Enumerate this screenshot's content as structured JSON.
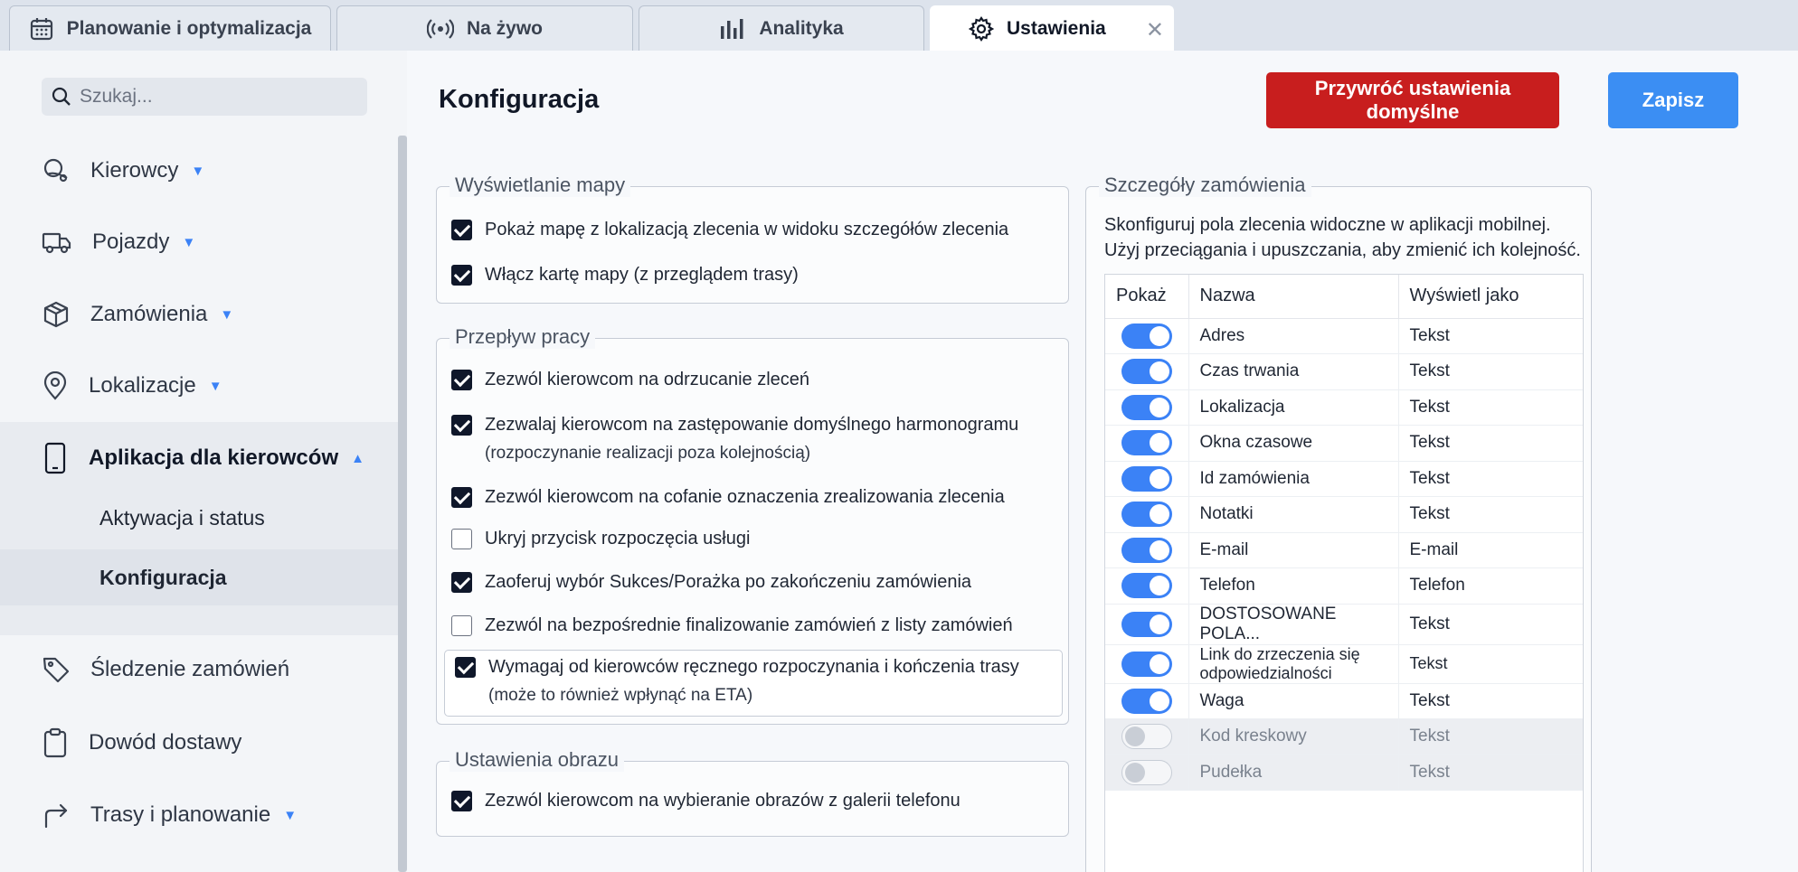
{
  "tabs": [
    {
      "label": "Planowanie i optymalizacja",
      "icon": "calendar-icon"
    },
    {
      "label": "Na żywo",
      "icon": "live-signal-icon"
    },
    {
      "label": "Analityka",
      "icon": "bar-chart-icon"
    },
    {
      "label": "Ustawienia",
      "icon": "gear-icon",
      "active": true
    }
  ],
  "tab_close": "✕",
  "sidebar": {
    "search_placeholder": "Szukaj...",
    "items": [
      {
        "label": "Kierowcy",
        "icon": "drivers-icon",
        "expandable": true
      },
      {
        "label": "Pojazdy",
        "icon": "truck-icon",
        "expandable": true
      },
      {
        "label": "Zamówienia",
        "icon": "box-icon",
        "expandable": true
      },
      {
        "label": "Lokalizacje",
        "icon": "location-pin-icon",
        "expandable": true
      },
      {
        "label": "Aplikacja dla kierowców",
        "icon": "phone-icon",
        "expanded": true
      },
      {
        "label": "Śledzenie zamówień",
        "icon": "tag-icon"
      },
      {
        "label": "Dowód dostawy",
        "icon": "clipboard-icon"
      },
      {
        "label": "Trasy i planowanie",
        "icon": "route-arrow-icon",
        "expandable": true
      }
    ],
    "subitems": [
      {
        "label": "Aktywacja i status"
      },
      {
        "label": "Konfiguracja",
        "selected": true
      }
    ]
  },
  "main": {
    "title": "Konfiguracja",
    "reset_label": "Przywróć ustawienia domyślne",
    "save_label": "Zapisz"
  },
  "map_display": {
    "legend": "Wyświetlanie mapy",
    "options": [
      {
        "label": "Pokaż mapę z lokalizacją zlecenia w widoku szczegółów zlecenia",
        "checked": true
      },
      {
        "label": "Włącz kartę mapy (z przeglądem trasy)",
        "checked": true
      }
    ]
  },
  "workflow": {
    "legend": "Przepływ pracy",
    "options": [
      {
        "label": "Zezwól kierowcom na odrzucanie zleceń",
        "checked": true
      },
      {
        "label": "Zezwalaj kierowcom na zastępowanie domyślnego harmonogramu",
        "sub": "(rozpoczynanie realizacji poza kolejnością)",
        "checked": true
      },
      {
        "label": "Zezwól kierowcom na cofanie oznaczenia zrealizowania zlecenia",
        "checked": true
      },
      {
        "label": "Ukryj przycisk rozpoczęcia usługi",
        "checked": false
      },
      {
        "label": "Zaoferuj wybór Sukces/Porażka po zakończeniu zamówienia",
        "checked": true
      },
      {
        "label": "Zezwól na bezpośrednie finalizowanie zamówień z listy zamówień",
        "checked": false
      },
      {
        "label": "Wymagaj od kierowców ręcznego rozpoczynania i kończenia trasy",
        "sub": "(może to również wpłynąć na ETA)",
        "checked": true
      }
    ]
  },
  "image_settings": {
    "legend": "Ustawienia obrazu",
    "options": [
      {
        "label": "Zezwól kierowcom na wybieranie obrazów z galerii telefonu",
        "checked": true
      }
    ]
  },
  "order_details": {
    "legend": "Szczegóły zamówienia",
    "description_line1": "Skonfiguruj pola zlecenia widoczne w aplikacji mobilnej.",
    "description_line2": "Użyj przeciągania i upuszczania, aby zmienić ich kolejność.",
    "columns": [
      "Pokaż",
      "Nazwa",
      "Wyświetl jako"
    ],
    "rows": [
      {
        "show": true,
        "name": "Adres",
        "display": "Tekst"
      },
      {
        "show": true,
        "name": "Czas trwania",
        "display": "Tekst"
      },
      {
        "show": true,
        "name": "Lokalizacja",
        "display": "Tekst"
      },
      {
        "show": true,
        "name": "Okna czasowe",
        "display": "Tekst"
      },
      {
        "show": true,
        "name": "Id zamówienia",
        "display": "Tekst"
      },
      {
        "show": true,
        "name": "Notatki",
        "display": "Tekst"
      },
      {
        "show": true,
        "name": "E-mail",
        "display": "E-mail"
      },
      {
        "show": true,
        "name": "Telefon",
        "display": "Telefon"
      },
      {
        "show": true,
        "name": "DOSTOSOWANE POLA...",
        "display": "Tekst"
      },
      {
        "show": true,
        "name": "Link do zrzeczenia się odpowiedzialności",
        "display": "Tekst"
      },
      {
        "show": true,
        "name": "Waga",
        "display": "Tekst"
      },
      {
        "show": false,
        "name": "Kod kreskowy",
        "display": "Tekst"
      },
      {
        "show": false,
        "name": "Pudełka",
        "display": "Tekst"
      }
    ]
  },
  "colors": {
    "accent_blue": "#3b82f6",
    "danger_red": "#c81e1e",
    "save_blue": "#3b8ef3"
  }
}
